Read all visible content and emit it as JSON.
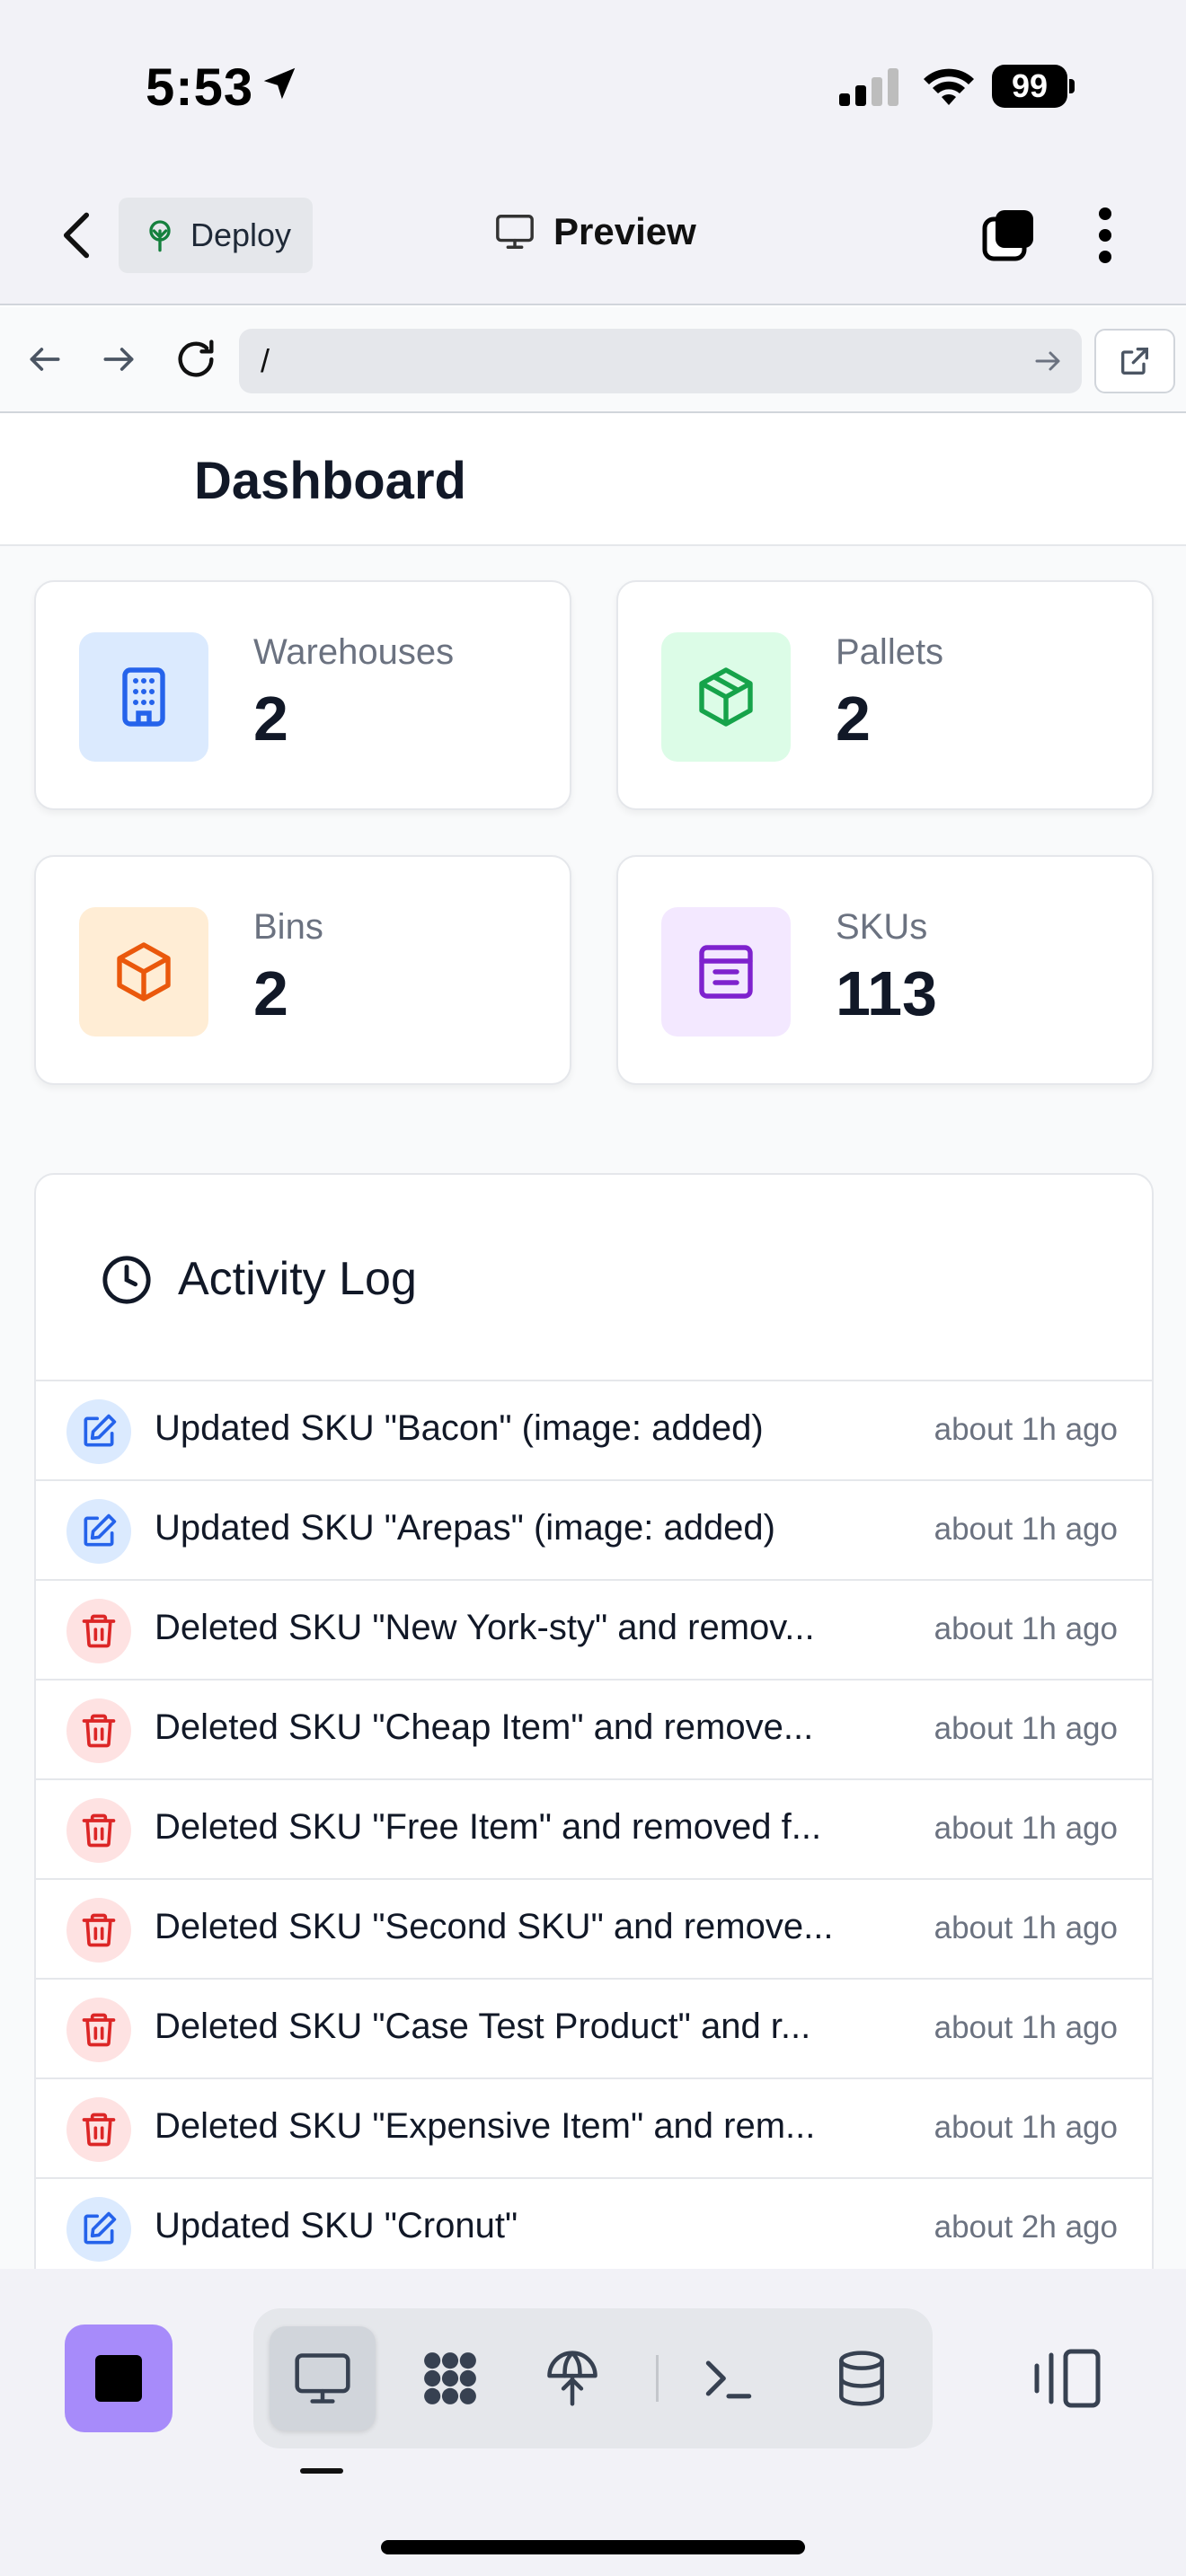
{
  "status_bar": {
    "time": "5:53",
    "battery": "99"
  },
  "header": {
    "deploy_label": "Deploy",
    "title": "Preview"
  },
  "url_bar": {
    "value": "/"
  },
  "dashboard": {
    "title": "Dashboard",
    "stats": [
      {
        "label": "Warehouses",
        "value": "2",
        "icon": "building-icon",
        "color": "#2563eb",
        "bg": "#dbeafe"
      },
      {
        "label": "Pallets",
        "value": "2",
        "icon": "package-icon",
        "color": "#16a34a",
        "bg": "#dcfce7"
      },
      {
        "label": "Bins",
        "value": "2",
        "icon": "box-icon",
        "color": "#ea580c",
        "bg": "#ffedd5"
      },
      {
        "label": "SKUs",
        "value": "113",
        "icon": "archive-icon",
        "color": "#7e22ce",
        "bg": "#f3e8ff"
      }
    ],
    "activity_log": {
      "title": "Activity Log",
      "items": [
        {
          "type": "update",
          "text": "Updated SKU \"Bacon\" (image: added)",
          "time": "about 1h ago"
        },
        {
          "type": "update",
          "text": "Updated SKU \"Arepas\" (image: added)",
          "time": "about 1h ago"
        },
        {
          "type": "delete",
          "text": "Deleted SKU \"New York-sty\" and remov...",
          "time": "about 1h ago"
        },
        {
          "type": "delete",
          "text": "Deleted SKU \"Cheap Item\" and remove...",
          "time": "about 1h ago"
        },
        {
          "type": "delete",
          "text": "Deleted SKU \"Free Item\" and removed f...",
          "time": "about 1h ago"
        },
        {
          "type": "delete",
          "text": "Deleted SKU \"Second SKU\" and remove...",
          "time": "about 1h ago"
        },
        {
          "type": "delete",
          "text": "Deleted SKU \"Case Test Product\" and r...",
          "time": "about 1h ago"
        },
        {
          "type": "delete",
          "text": "Deleted SKU \"Expensive Item\" and rem...",
          "time": "about 1h ago"
        },
        {
          "type": "update",
          "text": "Updated SKU \"Cronut\"",
          "time": "about 2h ago"
        }
      ]
    }
  },
  "colors": {
    "update_icon": "#2563eb",
    "delete_icon": "#dc2626",
    "accent": "#a78bfa"
  }
}
